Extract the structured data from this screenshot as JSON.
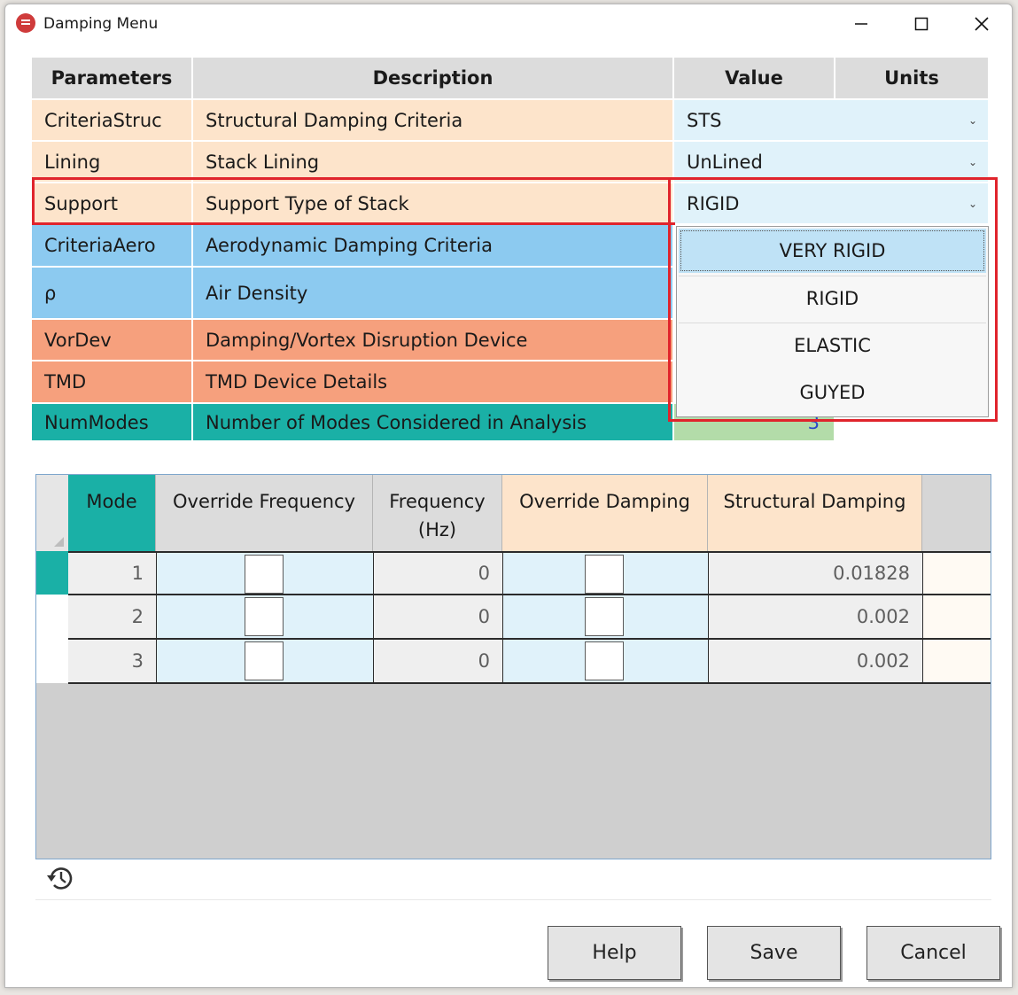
{
  "window": {
    "title": "Damping Menu"
  },
  "params_header": {
    "parameters": "Parameters",
    "description": "Description",
    "value": "Value",
    "units": "Units"
  },
  "params": [
    {
      "param": "CriteriaStruc",
      "description": "Structural Damping Criteria",
      "value": "STS",
      "color": "#fde4cb"
    },
    {
      "param": "Lining",
      "description": "Stack Lining",
      "value": "UnLined",
      "color": "#fde4cb"
    },
    {
      "param": "Support",
      "description": "Support Type of Stack",
      "value": "RIGID",
      "color": "#fde4cb"
    },
    {
      "param": "CriteriaAero",
      "description": "Aerodynamic Damping Criteria",
      "color": "#8ccaf0"
    },
    {
      "param": "ρ",
      "description": "Air Density",
      "color": "#8ccaf0"
    },
    {
      "param": "VorDev",
      "description": "Damping/Vortex Disruption Device",
      "color": "#f6a07d"
    },
    {
      "param": "TMD",
      "description": "TMD Device Details",
      "color": "#f6a07d"
    },
    {
      "param": "NumModes",
      "description": "Number of Modes Considered in Analysis",
      "value": "3",
      "color": "#1ab0a6"
    }
  ],
  "support_dropdown": {
    "options": [
      "VERY RIGID",
      "RIGID",
      "ELASTIC",
      "GUYED"
    ],
    "highlighted": "VERY RIGID"
  },
  "modes_header": {
    "mode": "Mode",
    "override_frequency": "Override Frequency",
    "frequency_line1": "Frequency",
    "frequency_line2": "(Hz)",
    "override_damping": "Override Damping",
    "structural_damping": "Structural Damping"
  },
  "modes": [
    {
      "mode": "1",
      "override_frequency": false,
      "frequency": "0",
      "override_damping": false,
      "structural_damping": "0.01828"
    },
    {
      "mode": "2",
      "override_frequency": false,
      "frequency": "0",
      "override_damping": false,
      "structural_damping": "0.002"
    },
    {
      "mode": "3",
      "override_frequency": false,
      "frequency": "0",
      "override_damping": false,
      "structural_damping": "0.002"
    }
  ],
  "buttons": {
    "help": "Help",
    "save": "Save",
    "cancel": "Cancel"
  },
  "icons": {
    "app": "app-logo-icon",
    "reset": "history-icon"
  },
  "colors": {
    "highlight_box": "#e0242c",
    "accent_teal": "#1ab0a6"
  }
}
